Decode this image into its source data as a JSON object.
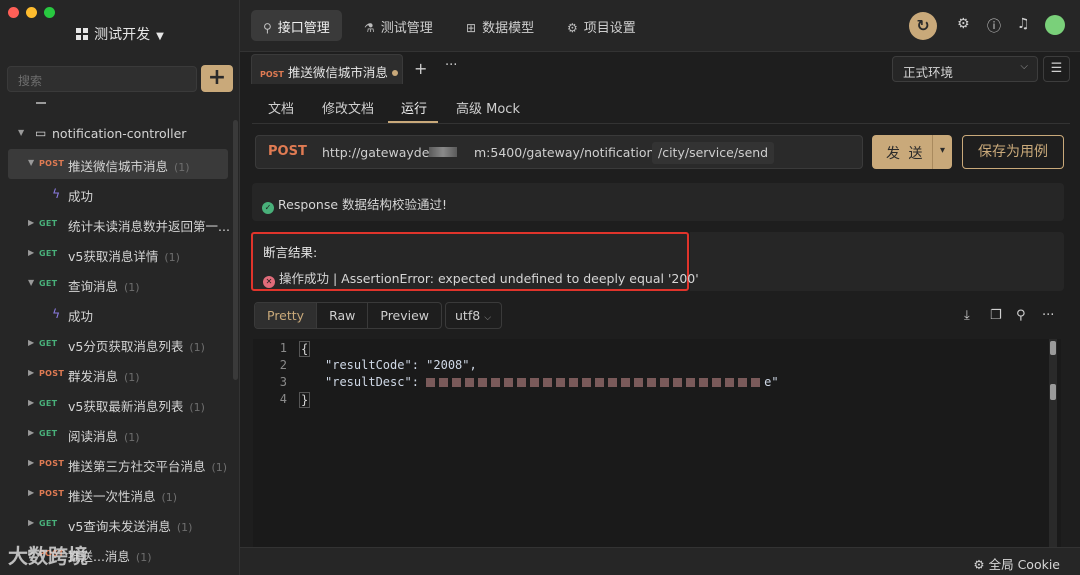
{
  "sidebar": {
    "project_title": "测试开发",
    "search_placeholder": "搜索",
    "add_label": "+",
    "folder": "notification-controller",
    "items": [
      {
        "method": "POST",
        "label": "推送微信城市消息",
        "count": "(1)"
      },
      {
        "label": "成功"
      },
      {
        "method": "GET",
        "label": "统计未读消息数并返回第一...",
        "count": ""
      },
      {
        "method": "GET",
        "label": "v5获取消息详情",
        "count": "(1)"
      },
      {
        "method": "GET",
        "label": "查询消息",
        "count": "(1)"
      },
      {
        "label": "成功"
      },
      {
        "method": "GET",
        "label": "v5分页获取消息列表",
        "count": "(1)"
      },
      {
        "method": "POST",
        "label": "群发消息",
        "count": "(1)"
      },
      {
        "method": "GET",
        "label": "v5获取最新消息列表",
        "count": "(1)"
      },
      {
        "method": "GET",
        "label": "阅读消息",
        "count": "(1)"
      },
      {
        "method": "POST",
        "label": "推送第三方社交平台消息",
        "count": "(1)"
      },
      {
        "method": "POST",
        "label": "推送一次性消息",
        "count": "(1)"
      },
      {
        "method": "GET",
        "label": "v5查询未发送消息",
        "count": "(1)"
      },
      {
        "method": "POST",
        "label": "推送...消息",
        "count": "(1)"
      }
    ]
  },
  "topbar": {
    "tabs": [
      {
        "label": "接口管理",
        "icon": "link-icon"
      },
      {
        "label": "测试管理",
        "icon": "flask-icon"
      },
      {
        "label": "数据模型",
        "icon": "model-icon"
      },
      {
        "label": "项目设置",
        "icon": "gear-icon"
      }
    ]
  },
  "request_tab": {
    "method": "POST",
    "label": "推送微信城市消息"
  },
  "environment": "正式环境",
  "subtabs": [
    "文档",
    "修改文档",
    "运行",
    "高级 Mock"
  ],
  "request": {
    "method": "POST",
    "url_host": "http://gatewayde",
    "url_port": "m:5400/gateway/notification",
    "url_path": "/city/service/send",
    "send_label": "发 送",
    "save_label": "保存为用例"
  },
  "response": {
    "schema_check": "Response 数据结构校验通过!",
    "assert_heading": "断言结果:",
    "assert_error": "操作成功 | AssertionError: expected undefined to deeply equal '200'",
    "views": [
      "Pretty",
      "Raw",
      "Preview"
    ],
    "encoding": "utf8",
    "code_lines": [
      "{",
      "\"resultCode\": \"2008\",",
      "\"resultDesc\":",
      "}"
    ],
    "line_numbers": [
      "1",
      "2",
      "3",
      "4"
    ],
    "desc_tail": "e\""
  },
  "footer": {
    "cookie": "全局 Cookie"
  },
  "watermark": "大数跨境",
  "colors": {
    "accent": "#c9a97a",
    "post": "#e07b53",
    "get": "#49b07a",
    "error": "#e0342b"
  }
}
